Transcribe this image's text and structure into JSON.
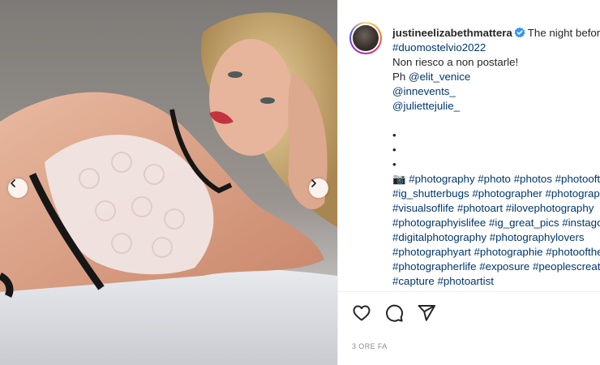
{
  "post": {
    "username": "justineelizabethmattera",
    "caption_lines": [
      {
        "kind": "head",
        "text": "The night before"
      },
      {
        "kind": "tag",
        "text": "#duomostelvio2022"
      },
      {
        "kind": "plain",
        "text": "Non riesco a non postarle!"
      },
      {
        "kind": "mixed",
        "prefix": "Ph ",
        "text": "@elit_venice"
      },
      {
        "kind": "tag",
        "text": "@innevents_"
      },
      {
        "kind": "tag",
        "text": "@juliettejulie_"
      },
      {
        "kind": "blank",
        "text": ""
      },
      {
        "kind": "plain",
        "text": "•"
      },
      {
        "kind": "plain",
        "text": "•"
      },
      {
        "kind": "plain",
        "text": "•"
      },
      {
        "kind": "tag",
        "prefix": "📷 ",
        "text": "#photography #photo #photos #photooftheday"
      },
      {
        "kind": "tag",
        "text": "#ig_shutterbugs #photographer #photographyislife"
      },
      {
        "kind": "tag",
        "text": "#visualsoflife #photoart #ilovephotography"
      },
      {
        "kind": "tag",
        "text": "#photographyislifee #ig_great_pics #instagood"
      },
      {
        "kind": "tag",
        "text": "#digitalphotography #photographylovers"
      },
      {
        "kind": "tag",
        "text": "#photographyart #photographie #photooftheday"
      },
      {
        "kind": "tag",
        "text": "#photographerlife #exposure #peoplescreatives"
      },
      {
        "kind": "tag",
        "text": "#capture #photoartist"
      }
    ],
    "timestamp": "3 ORE FA"
  },
  "icons": {
    "verified": "verified-badge-icon",
    "like": "heart-icon",
    "comment": "comment-bubble-icon",
    "share": "paper-plane-icon",
    "prev": "chevron-left-icon",
    "next": "chevron-right-icon",
    "camera": "camera-emoji"
  },
  "colors": {
    "username": "#262626",
    "link": "#00376b",
    "verified_blue": "#3897f0",
    "timestamp": "#8e8e8e"
  }
}
